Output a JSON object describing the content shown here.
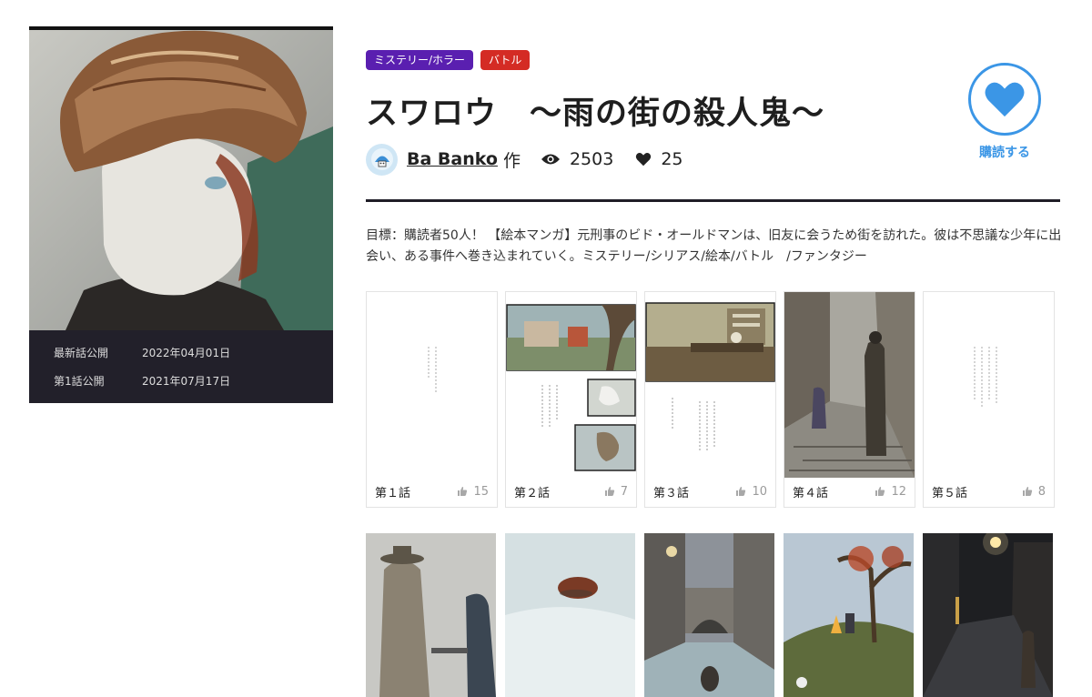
{
  "work": {
    "title": "スワロウ　〜雨の街の殺人鬼〜",
    "tags": [
      {
        "label": "ミステリー/ホラー",
        "color": "#5a1fb0"
      },
      {
        "label": "バトル",
        "color": "#d42b24"
      }
    ],
    "author": "Ba Banko",
    "author_suffix": "作",
    "views": "2503",
    "likes": "25",
    "description": "目標：購読者50人！ 【絵本マンガ】元刑事のビド・オールドマンは、旧友に会うため街を訪れた。彼は不思議な少年に出会い、ある事件へ巻き込まれていく。ミステリー/シリアス/絵本/バトル　/ファンタジー"
  },
  "dates": {
    "latest_label": "最新話公開",
    "latest_value": "2022年04月01日",
    "first_label": "第1話公開",
    "first_value": "2021年07月17日"
  },
  "subscribe": {
    "label": "購読する",
    "icon": "heart-icon",
    "color": "#3b96e6"
  },
  "episodes": [
    {
      "label": "第１話",
      "likes": "15"
    },
    {
      "label": "第２話",
      "likes": "7"
    },
    {
      "label": "第３話",
      "likes": "10"
    },
    {
      "label": "第４話",
      "likes": "12"
    },
    {
      "label": "第５話",
      "likes": "8"
    }
  ],
  "icons": {
    "views": "eye-icon",
    "likes": "heart-icon",
    "episode_likes": "thumbs-up-icon"
  }
}
